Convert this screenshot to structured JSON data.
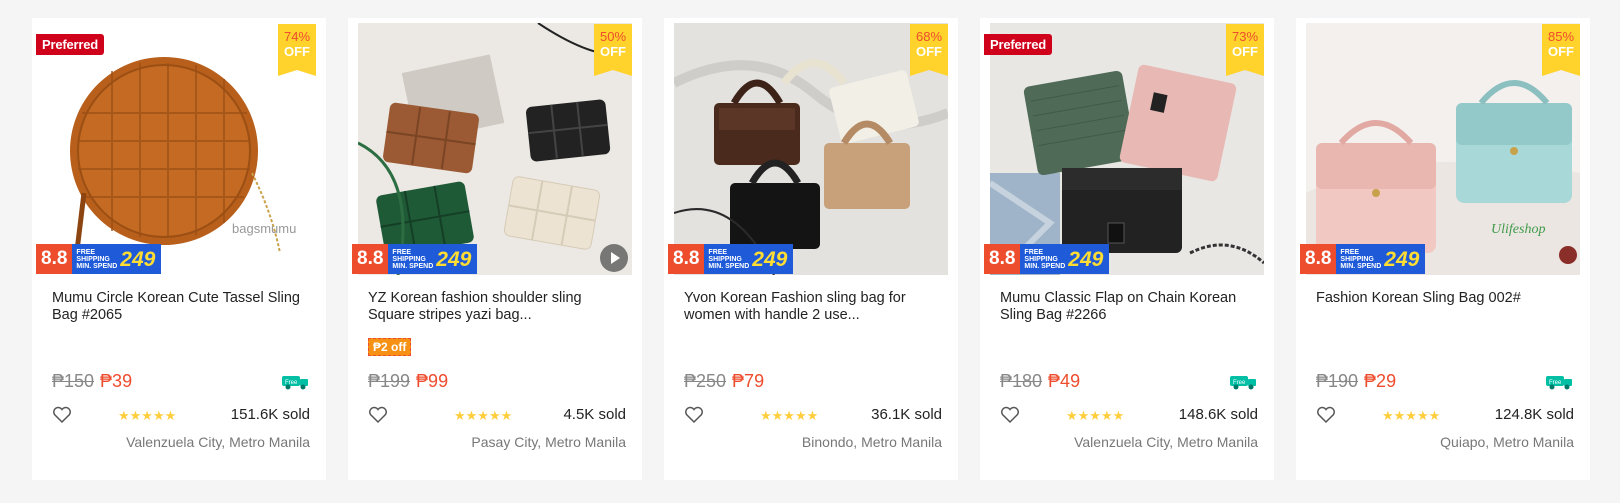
{
  "colors": {
    "accent": "#ee4d2d",
    "badge_yellow": "#ffd22c",
    "shipping_blue": "#1f5bd8",
    "free_green": "#00bfa5"
  },
  "promo": {
    "big_text": "8.8",
    "free_line1": "FREE",
    "free_line2": "SHIPPING",
    "free_line3": "MIN. SPEND",
    "min_spend": "249"
  },
  "products": [
    {
      "preferred": "Preferred",
      "discount_pct": "74%",
      "discount_off": "OFF",
      "name": "Mumu Circle Korean Cute Tassel Sling Bag #2065",
      "voucher": "",
      "old_price": "₱150",
      "new_price": "₱39",
      "free_shipping": "Free",
      "rating_stars": "★★★★★",
      "sold": "151.6K sold",
      "location": "Valenzuela City, Metro Manila",
      "watermark": "bagsmumu",
      "has_video": false
    },
    {
      "preferred": "",
      "discount_pct": "50%",
      "discount_off": "OFF",
      "name": "YZ Korean fashion shoulder sling Square stripes yazi bag...",
      "voucher": "₱2 off",
      "old_price": "₱199",
      "new_price": "₱99",
      "free_shipping": "",
      "rating_stars": "★★★★★",
      "sold": "4.5K sold",
      "location": "Pasay City, Metro Manila",
      "watermark": "",
      "has_video": true
    },
    {
      "preferred": "",
      "discount_pct": "68%",
      "discount_off": "OFF",
      "name": "Yvon Korean Fashion sling bag for women with handle 2 use...",
      "voucher": "",
      "old_price": "₱250",
      "new_price": "₱79",
      "free_shipping": "",
      "rating_stars": "★★★★★",
      "sold": "36.1K sold",
      "location": "Binondo, Metro Manila",
      "watermark": "",
      "has_video": false
    },
    {
      "preferred": "Preferred",
      "discount_pct": "73%",
      "discount_off": "OFF",
      "name": "Mumu Classic Flap on Chain Korean Sling Bag #2266",
      "voucher": "",
      "old_price": "₱180",
      "new_price": "₱49",
      "free_shipping": "Free",
      "rating_stars": "★★★★★",
      "sold": "148.6K sold",
      "location": "Valenzuela City, Metro Manila",
      "watermark": "",
      "has_video": false
    },
    {
      "preferred": "",
      "discount_pct": "85%",
      "discount_off": "OFF",
      "name": "Fashion Korean Sling Bag 002#",
      "voucher": "",
      "old_price": "₱190",
      "new_price": "₱29",
      "free_shipping": "Free",
      "rating_stars": "★★★★★",
      "sold": "124.8K sold",
      "location": "Quiapo, Metro Manila",
      "watermark": "Ulifeshop",
      "has_video": false
    }
  ]
}
